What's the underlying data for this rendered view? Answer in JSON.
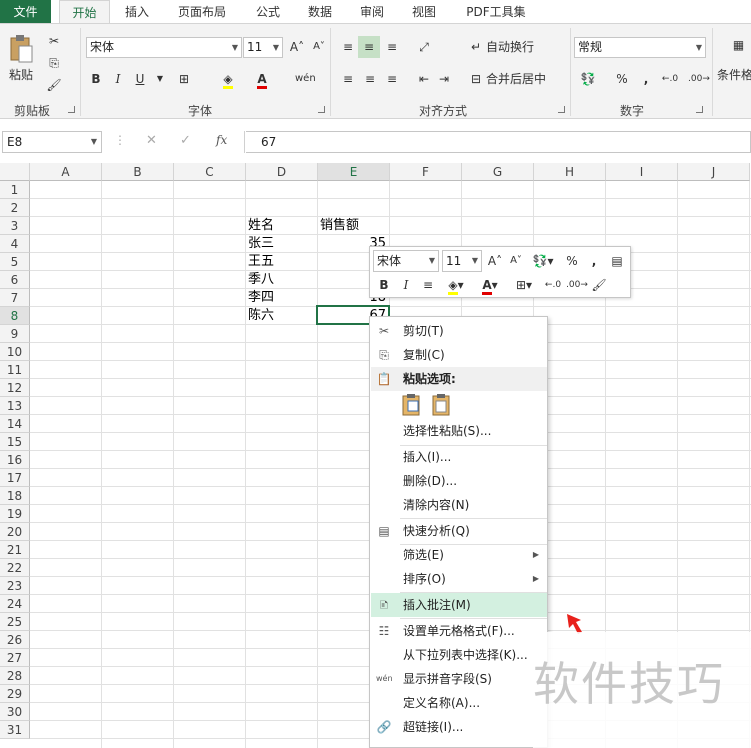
{
  "ribbon_tabs": [
    "文件",
    "开始",
    "插入",
    "页面布局",
    "公式",
    "数据",
    "审阅",
    "视图",
    "PDF工具集"
  ],
  "ribbon": {
    "clipboard": {
      "paste_label": "粘贴",
      "group_label": "剪贴板"
    },
    "font": {
      "font_name": "宋体",
      "font_size": "11",
      "bold": "B",
      "italic": "I",
      "underline": "U",
      "group_label": "字体"
    },
    "alignment": {
      "wrap_text": "自动换行",
      "merge_center": "合并后居中",
      "group_label": "对齐方式"
    },
    "number": {
      "format": "常规",
      "percent": "%",
      "comma": ",",
      "group_label": "数字"
    },
    "styles": {
      "conditional_format": "条件格"
    }
  },
  "formula_bar": {
    "name_box": "E8",
    "fx": "fx",
    "value": "67"
  },
  "columns": [
    "A",
    "B",
    "C",
    "D",
    "E",
    "F",
    "G",
    "H",
    "I",
    "J"
  ],
  "rows": [
    "1",
    "2",
    "3",
    "4",
    "5",
    "6",
    "7",
    "8",
    "9",
    "10",
    "11",
    "12",
    "13",
    "14",
    "15",
    "16",
    "17",
    "18",
    "19",
    "20",
    "21",
    "22",
    "23",
    "24",
    "25",
    "26",
    "27",
    "28",
    "29",
    "30",
    "31"
  ],
  "cells": {
    "header_name": "姓名",
    "header_sales": "销售额",
    "names": [
      "张三",
      "王五",
      "季八",
      "李四",
      "陈六"
    ],
    "sales_partial": [
      "35",
      "",
      "",
      "18",
      "67"
    ]
  },
  "mini_toolbar": {
    "font_name": "宋体",
    "font_size": "11",
    "percent": "%",
    "comma": ",",
    "bold": "B",
    "italic": "I"
  },
  "context_menu": {
    "items": [
      {
        "label": "剪切(T)",
        "icon": "scissors-icon"
      },
      {
        "label": "复制(C)",
        "icon": "copy-icon"
      },
      {
        "label": "粘贴选项:",
        "icon": "paste-icon"
      },
      {
        "label": "选择性粘贴(S)...",
        "icon": ""
      },
      {
        "label": "插入(I)...",
        "icon": ""
      },
      {
        "label": "删除(D)...",
        "icon": ""
      },
      {
        "label": "清除内容(N)",
        "icon": ""
      },
      {
        "label": "快速分析(Q)",
        "icon": "quick-analysis-icon"
      },
      {
        "label": "筛选(E)",
        "icon": ""
      },
      {
        "label": "排序(O)",
        "icon": ""
      },
      {
        "label": "插入批注(M)",
        "icon": "comment-icon"
      },
      {
        "label": "设置单元格格式(F)...",
        "icon": "format-cells-icon"
      },
      {
        "label": "从下拉列表中选择(K)...",
        "icon": ""
      },
      {
        "label": "显示拼音字段(S)",
        "icon": "phonetic-icon"
      },
      {
        "label": "定义名称(A)...",
        "icon": ""
      },
      {
        "label": "超链接(I)...",
        "icon": "hyperlink-icon"
      }
    ]
  },
  "watermark": "软件技巧",
  "colors": {
    "accent": "#217346",
    "hover": "#d3f0e0",
    "cursor_arrow": "#e8211b"
  }
}
